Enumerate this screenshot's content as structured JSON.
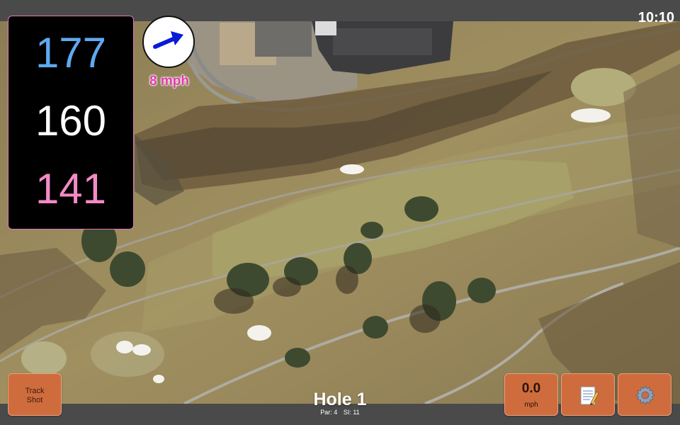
{
  "status": {
    "time": "10:10"
  },
  "distances": {
    "back": "177",
    "middle": "160",
    "front": "141"
  },
  "wind": {
    "speed_label": "8 mph",
    "icon": "wind-direction-arrow-icon",
    "direction_color": "#0a1bd6"
  },
  "hole": {
    "title": "Hole 1",
    "par_label": "Par: 4",
    "si_label": "SI: 11"
  },
  "buttons": {
    "track_shot_label": "Track\nShot",
    "speed_value": "0.0",
    "speed_unit": "mph",
    "notes_icon": "notepad-icon",
    "settings_icon": "gear-icon"
  },
  "colors": {
    "back_distance": "#5fa9f0",
    "middle_distance": "#ffffff",
    "front_distance": "#f38ac6",
    "button_bg": "#cf6c3d",
    "wind_text": "#e03caa",
    "bar_bg": "#4a4a4a"
  }
}
